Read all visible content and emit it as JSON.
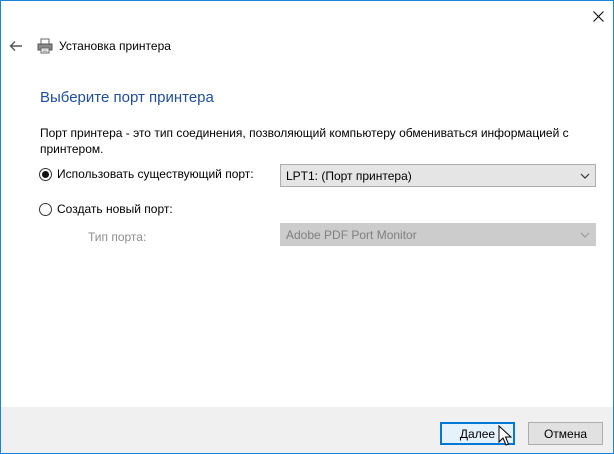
{
  "window": {
    "header_title": "Установка принтера"
  },
  "main": {
    "page_title": "Выберите порт принтера",
    "description": "Порт принтера - это тип соединения, позволяющий компьютеру обмениваться информацией с принтером.",
    "use_existing_port": {
      "label": "Использовать существующий порт:",
      "selected": true,
      "value": "LPT1: (Порт принтера)"
    },
    "create_new_port": {
      "label": "Создать новый порт:",
      "selected": false,
      "port_type_label": "Тип порта:",
      "port_type_value": "Adobe PDF Port Monitor",
      "enabled": false
    }
  },
  "footer": {
    "next_label": "Далее",
    "cancel_label": "Отмена"
  },
  "colors": {
    "accent": "#0078d7",
    "title_blue": "#1f4e9e",
    "disabled_text": "#8c8c8c",
    "footer_bg": "#f0f0f0"
  },
  "icons": [
    "close-icon",
    "back-arrow-icon",
    "printer-icon",
    "chevron-down-icon",
    "mouse-cursor-icon"
  ]
}
